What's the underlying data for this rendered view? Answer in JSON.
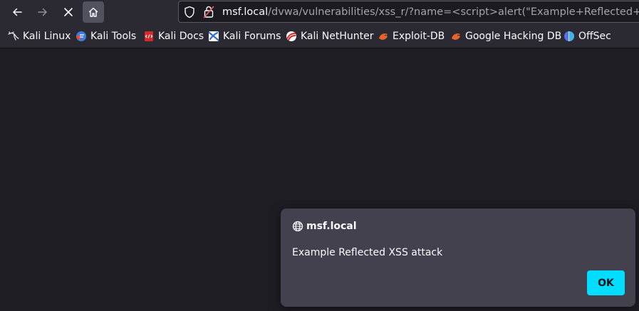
{
  "browser": {
    "nav": {
      "back_icon": "arrow-left-icon",
      "forward_icon": "arrow-right-icon",
      "stop_icon": "close-icon",
      "home_icon": "home-icon"
    },
    "url": {
      "host": "msf.local",
      "path": "/dvwa/vulnerabilities/xss_r/?name=<script>alert(\"Example+Reflected+XSS+a"
    },
    "bookmarks": [
      {
        "label": "Kali Linux",
        "icon": "kali-dragon-icon"
      },
      {
        "label": "Kali Tools",
        "icon": "kali-tools-icon"
      },
      {
        "label": "Kali Docs",
        "icon": "kali-docs-icon"
      },
      {
        "label": "Kali Forums",
        "icon": "kali-forums-icon"
      },
      {
        "label": "Kali NetHunter",
        "icon": "kali-nethunter-icon"
      },
      {
        "label": "Exploit-DB",
        "icon": "exploit-db-icon"
      },
      {
        "label": "Google Hacking DB",
        "icon": "google-hacking-db-icon"
      },
      {
        "label": "OffSec",
        "icon": "offsec-icon"
      }
    ]
  },
  "dialog": {
    "origin": "msf.local",
    "message": "Example Reflected XSS attack",
    "ok_label": "OK"
  },
  "colors": {
    "toolbar": "#2b2a33",
    "content": "#1e1d24",
    "dialog": "#42414d",
    "accent": "#00ddff"
  }
}
